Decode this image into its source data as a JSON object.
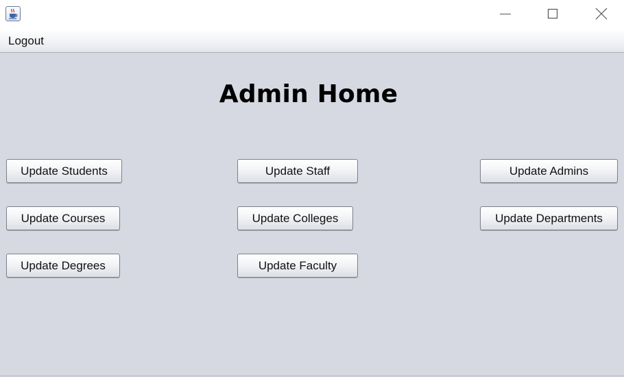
{
  "titlebar": {
    "app_icon": "java-cup-icon",
    "controls": [
      "minimize-icon",
      "maximize-icon",
      "close-icon"
    ]
  },
  "menubar": {
    "items": [
      {
        "label": "Logout"
      }
    ]
  },
  "main": {
    "title": "Admin Home",
    "buttons": {
      "students": "Update Students",
      "staff": "Update Staff",
      "admins": "Update Admins",
      "courses": "Update Courses",
      "colleges": "Update Colleges",
      "departments": "Update Departments",
      "degrees": "Update Degrees",
      "faculty": "Update Faculty"
    }
  },
  "colors": {
    "content_background": "#d6d9e1",
    "button_border": "#7a7f88"
  }
}
